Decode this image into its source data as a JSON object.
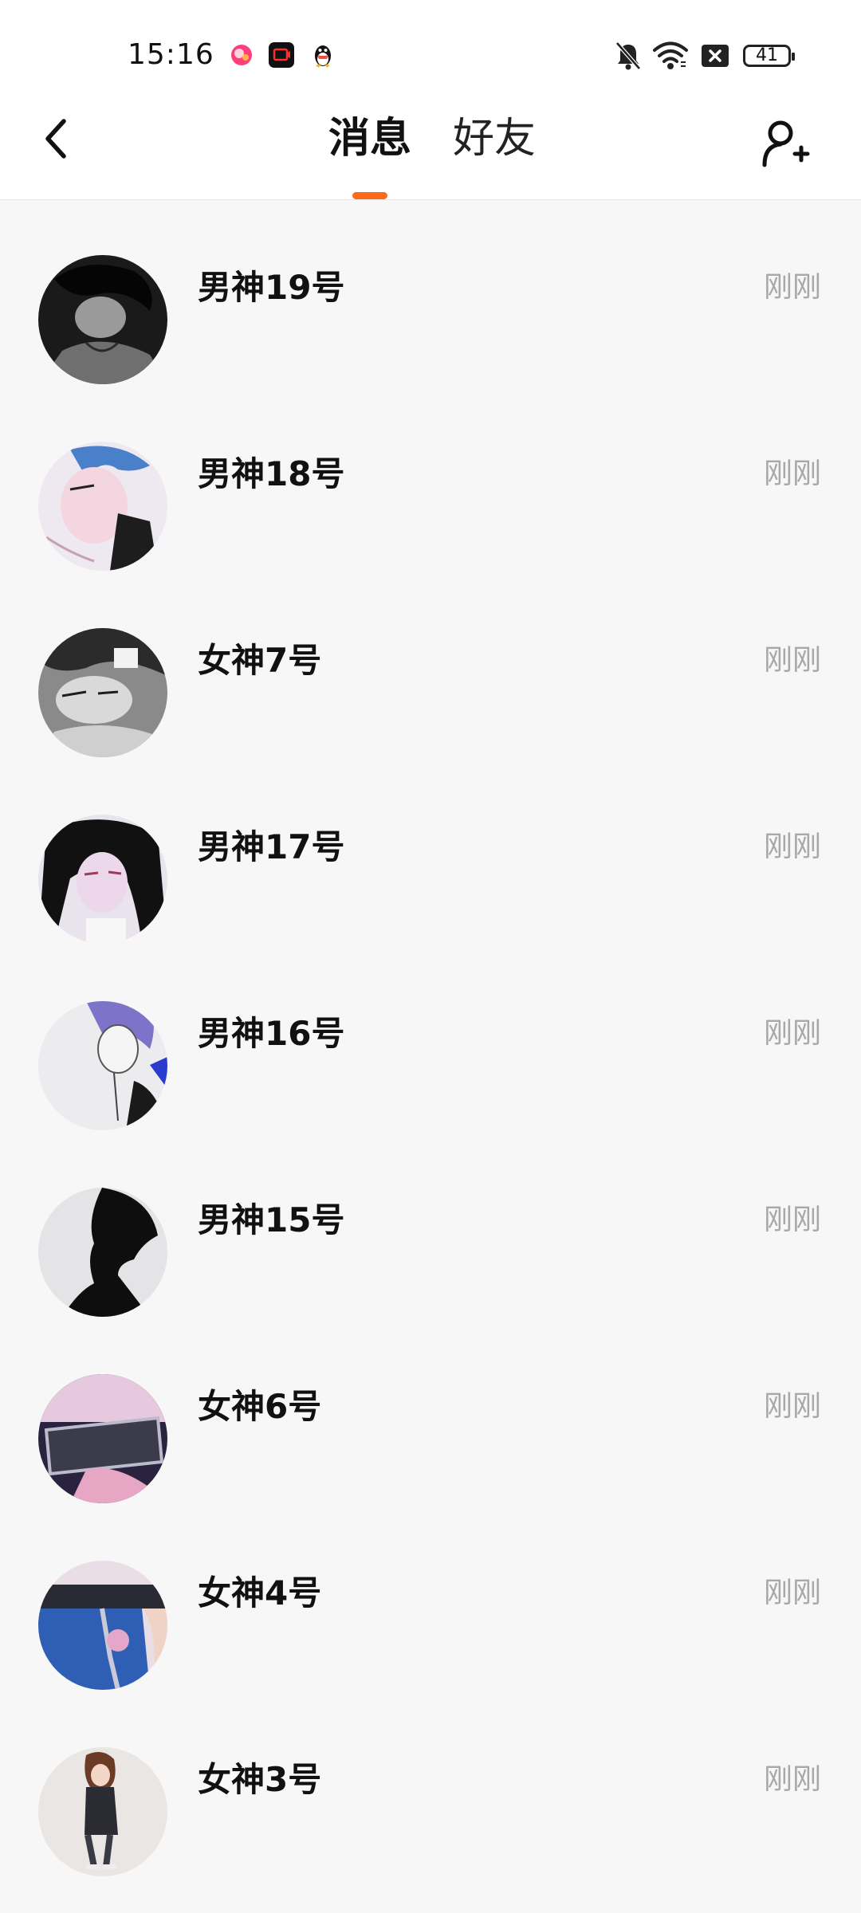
{
  "status_bar": {
    "time": "15:16",
    "battery": "41",
    "icons": [
      "app-notification-icon",
      "video-app-icon",
      "qq-penguin-icon",
      "mute-bell-icon",
      "wifi-icon",
      "sim-x-icon",
      "battery-icon"
    ]
  },
  "nav": {
    "tabs": [
      {
        "label": "消息",
        "active": true
      },
      {
        "label": "好友",
        "active": false
      }
    ],
    "accent_color": "#ff6a1a"
  },
  "conversations": [
    {
      "name": "男神19号",
      "time": "刚刚"
    },
    {
      "name": "男神18号",
      "time": "刚刚"
    },
    {
      "name": "女神7号",
      "time": "刚刚"
    },
    {
      "name": "男神17号",
      "time": "刚刚"
    },
    {
      "name": "男神16号",
      "time": "刚刚"
    },
    {
      "name": "男神15号",
      "time": "刚刚"
    },
    {
      "name": "女神6号",
      "time": "刚刚"
    },
    {
      "name": "女神4号",
      "time": "刚刚"
    },
    {
      "name": "女神3号",
      "time": "刚刚"
    }
  ]
}
